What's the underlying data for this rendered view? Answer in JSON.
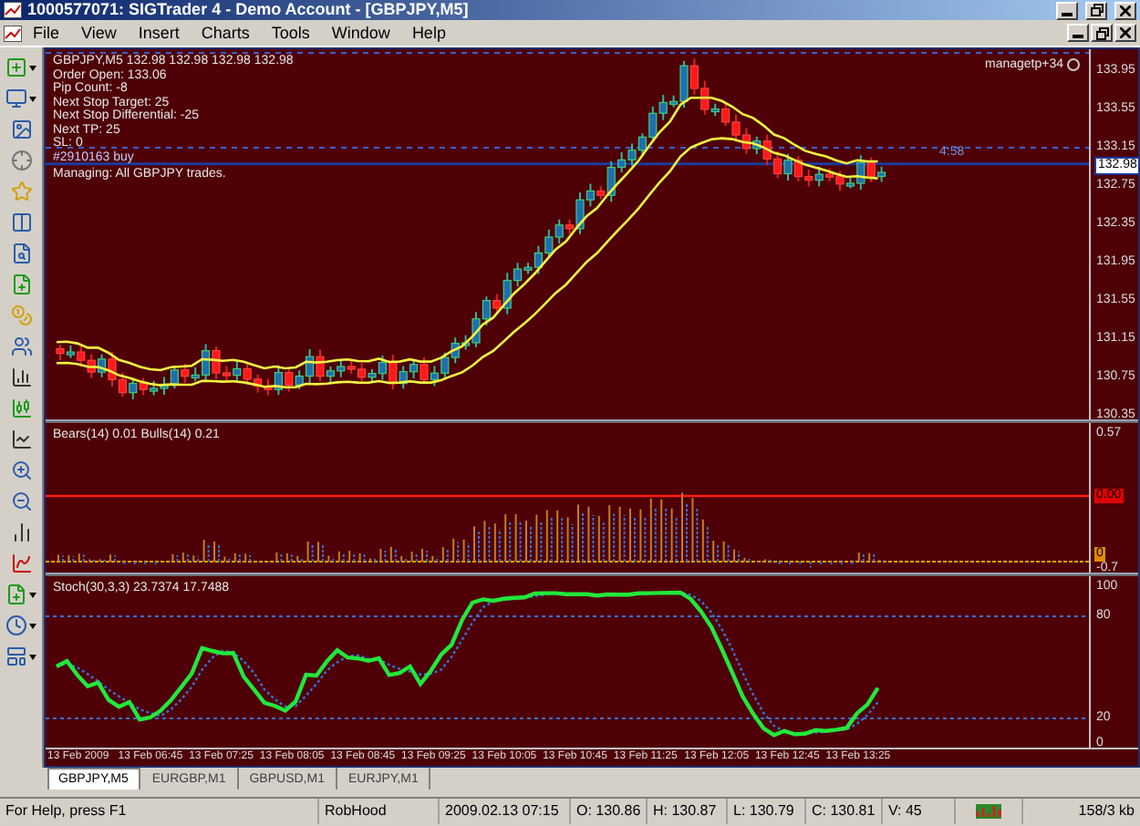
{
  "window": {
    "title": "1000577071: SIGTrader 4 - Demo Account - [GBPJPY,M5]"
  },
  "menu": {
    "items": [
      "File",
      "View",
      "Insert",
      "Charts",
      "Tools",
      "Window",
      "Help"
    ]
  },
  "chart": {
    "info_lines": [
      "GBPJPY,M5  132.98 132.98 132.98 132.98",
      "Order Open: 133.06",
      "Pip Count: -8",
      "Next Stop Target: 25",
      "Next Stop Differential: -25",
      "Next TP: 25",
      "SL: 0"
    ],
    "order_label": "#2910163 buy",
    "managing": "Managing: All GBPJPY trades.",
    "expert_label": "managetp+34",
    "trade_marker": "4:58",
    "price_ticks": [
      "133.95",
      "133.55",
      "133.15",
      "132.75",
      "132.35",
      "131.95",
      "131.55",
      "131.15",
      "130.75",
      "130.35"
    ],
    "current_price": "132.98"
  },
  "bears_bulls": {
    "legend": "Bears(14) 0.01  Bulls(14) 0.21",
    "ticks": [
      {
        "label": "0.57",
        "kind": "plain"
      },
      {
        "label": "0.00",
        "kind": "marker",
        "color": "#e00000"
      },
      {
        "label": "0",
        "kind": "marker",
        "color": "#e08a00"
      },
      {
        "label": "-0.7",
        "kind": "plain"
      }
    ]
  },
  "stochastic": {
    "legend": "Stoch(30,3,3) 23.7374 17.7488",
    "ticks": [
      "100",
      "80",
      "20",
      "0"
    ]
  },
  "time_axis": [
    "13 Feb 2009",
    "13 Feb 06:45",
    "13 Feb 07:25",
    "13 Feb 08:05",
    "13 Feb 08:45",
    "13 Feb 09:25",
    "13 Feb 10:05",
    "13 Feb 10:45",
    "13 Feb 11:25",
    "13 Feb 12:05",
    "13 Feb 12:45",
    "13 Feb 13:25"
  ],
  "tabs": [
    {
      "label": "GBPJPY,M5",
      "selected": true
    },
    {
      "label": "EURGBP,M1",
      "selected": false
    },
    {
      "label": "GBPUSD,M1",
      "selected": false
    },
    {
      "label": "EURJPY,M1",
      "selected": false
    }
  ],
  "status_bar": {
    "help": "For Help, press F1",
    "profile": "RobHood",
    "datetime": "2009.02.13 07:15",
    "open": "O: 130.86",
    "high": "H: 130.87",
    "low": "L: 130.79",
    "close": "C: 130.81",
    "volume": "V: 45",
    "traffic": "158/3 kb"
  }
}
